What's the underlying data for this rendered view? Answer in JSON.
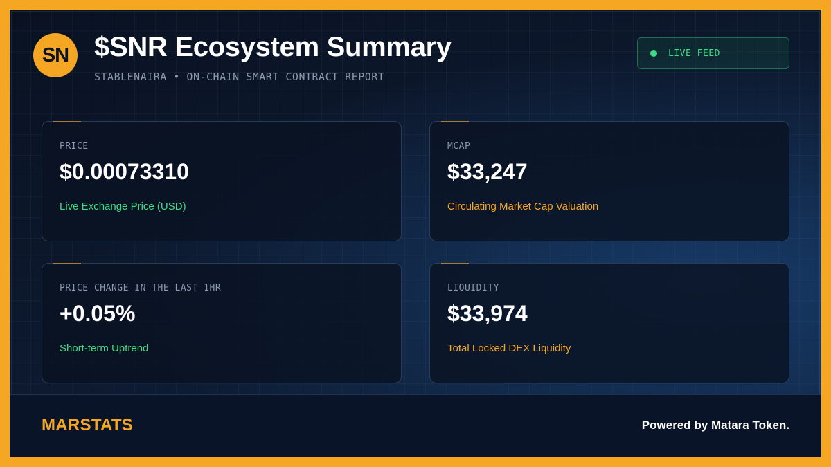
{
  "header": {
    "logo_text": "SN",
    "title": "$SNR Ecosystem Summary",
    "subtitle": "STABLENAIRA • ON-CHAIN SMART CONTRACT REPORT",
    "live_label": "LIVE FEED"
  },
  "cards": [
    {
      "label": "PRICE",
      "value": "$0.00073310",
      "desc": "Live Exchange Price (USD)"
    },
    {
      "label": "MCAP",
      "value": "$33,247",
      "desc": "Circulating Market Cap Valuation"
    },
    {
      "label": "PRICE CHANGE IN THE LAST 1HR",
      "value": "+0.05%",
      "desc": "Short-term Uptrend"
    },
    {
      "label": "LIQUIDITY",
      "value": "$33,974",
      "desc": "Total Locked DEX Liquidity"
    }
  ],
  "footer": {
    "brand": "MARSTATS",
    "powered_by": "Powered by Matara Token."
  },
  "colors": {
    "accent": "#f5a623",
    "positive": "#3ddc84",
    "background": "#0b1220"
  }
}
